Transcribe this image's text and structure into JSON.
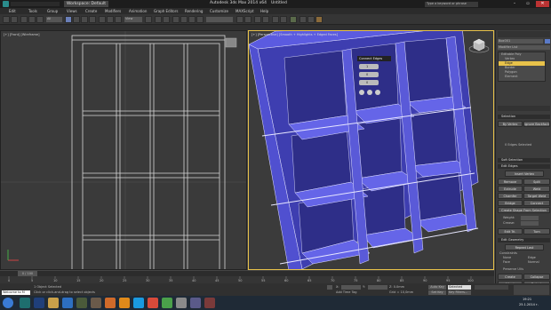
{
  "titlebar": {
    "workspace": "Workspace: Default",
    "app_title": "Autodesk 3ds Max  2014 x64",
    "file_title": "Untitled",
    "search_placeholder": "Type a keyword or phrase"
  },
  "menu": [
    "Edit",
    "Tools",
    "Group",
    "Views",
    "Create",
    "Modifiers",
    "Animation",
    "Graph Editors",
    "Rendering",
    "Customize",
    "MAXScript",
    "Help"
  ],
  "viewports": {
    "left_label": "[+] [Front] [Wireframe]",
    "right_label": "[+] [Perspective] [Smooth + Highlights + Edged Faces]"
  },
  "caddy": {
    "title": "Connect Edges",
    "segments": "1",
    "pinch": "0",
    "slide": "0"
  },
  "command_panel": {
    "object_name": "Box001",
    "modifier_list": "Modifier List",
    "stack": [
      "Editable Poly",
      "Vertex",
      "Edge",
      "Border",
      "Polygon",
      "Element"
    ],
    "selected_stack_index": 2,
    "selection_header": "Selection",
    "by_vertex": "By Vertex",
    "ignore_backfacing": "Ignore Backfacing",
    "edges_selected": "0 Edges Selected",
    "soft_selection": "Soft Selection",
    "edit_edges": "Edit Edges",
    "insert_vertex": "Insert Vertex",
    "remove": "Remove",
    "split": "Split",
    "extrude": "Extrude",
    "weld": "Weld",
    "chamfer": "Chamfer",
    "target_weld": "Target Weld",
    "bridge": "Bridge",
    "connect": "Connect",
    "create_shape": "Create Shape From Selection",
    "weight": "Weight:",
    "crease": "Crease:",
    "edit_tri": "Edit Tri.",
    "turn": "Turn",
    "edit_geometry": "Edit Geometry",
    "repeat_last": "Repeat Last",
    "constraints": "Constraints",
    "none": "None",
    "edge": "Edge",
    "face": "Face",
    "normal": "Normal",
    "preserve_uvs": "Preserve UVs",
    "create": "Create",
    "collapse": "Collapse",
    "attach": "Attach",
    "detach": "Detach",
    "slice_plane": "Slice Plane",
    "split2": "Split",
    "slice": "Slice",
    "reset_plane": "Reset Plane",
    "quickslice": "QuickSlice",
    "cut": "Cut"
  },
  "timeline": {
    "slider_label": "0 / 100",
    "ticks": [
      "0",
      "5",
      "10",
      "15",
      "20",
      "25",
      "30",
      "35",
      "40",
      "45",
      "50",
      "55",
      "60",
      "65",
      "70",
      "75",
      "80",
      "85",
      "90",
      "95",
      "100"
    ]
  },
  "status": {
    "welcome": "Welcome to M",
    "objects_selected": "1 Object Selected",
    "prompt": "Click or click-and-drag to select objects",
    "x_label": "X:",
    "y_label": "Y:",
    "z_label": "Z: 0.0mm",
    "grid": "Grid = 10,0mm",
    "add_time_tag": "Add Time Tag",
    "autokey": "Auto Key",
    "selected": "Selected",
    "set_key": "Set Key",
    "key_filters": "Key Filters..."
  },
  "taskbar": {
    "time": "19:21",
    "date": "25.1.2014 г."
  },
  "colors": {
    "accent": "#e8c24a",
    "selection_blue": "#4a5ad8",
    "viewport_bg": "#3a3a3a"
  }
}
